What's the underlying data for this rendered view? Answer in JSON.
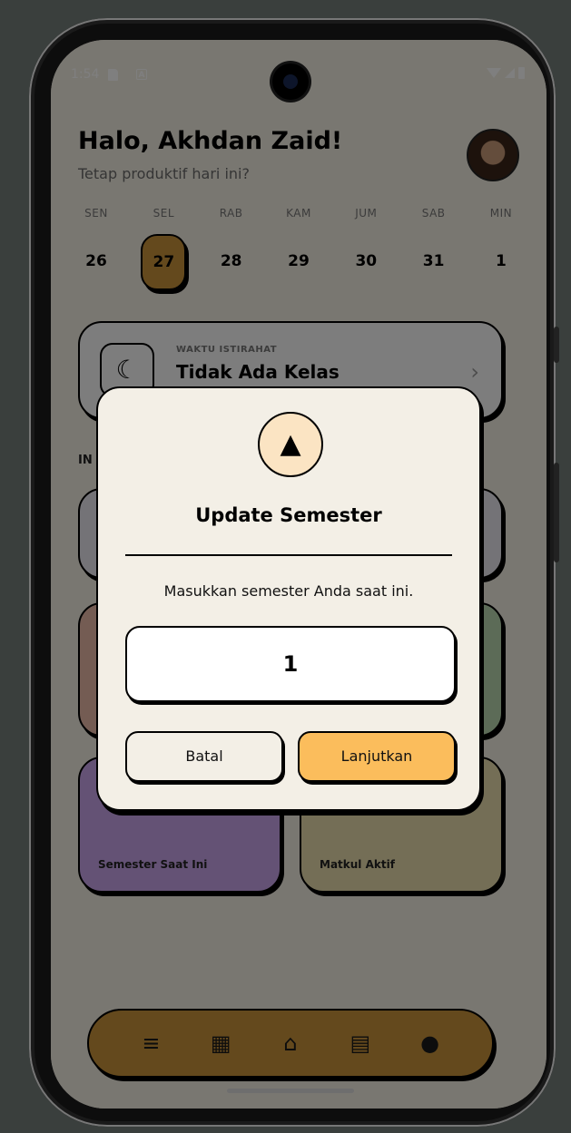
{
  "status": {
    "time": "1:54",
    "notif_a": "A"
  },
  "header": {
    "greeting": "Halo, Akhdan Zaid!",
    "subtitle": "Tetap produktif hari ini?"
  },
  "calendar": {
    "days": [
      {
        "name": "SEN",
        "date": "26"
      },
      {
        "name": "SEL",
        "date": "27",
        "active": true
      },
      {
        "name": "RAB",
        "date": "28"
      },
      {
        "name": "KAM",
        "date": "29"
      },
      {
        "name": "JUM",
        "date": "30"
      },
      {
        "name": "SAB",
        "date": "31"
      },
      {
        "name": "MIN",
        "date": "1"
      }
    ]
  },
  "rest_card": {
    "label": "WAKTU ISTIRAHAT",
    "title": "Tidak Ada Kelas",
    "icon": "moon-icon"
  },
  "section": {
    "label": "IN"
  },
  "stats": {
    "semester_label": "Semester Saat Ini",
    "courses_label": "Matkul Aktif"
  },
  "nav": {
    "icons": [
      "edit-list-icon",
      "calendar-icon",
      "home-icon",
      "clipboard-icon",
      "person-icon"
    ]
  },
  "dialog": {
    "icon": "graduation-cap-icon",
    "title": "Update Semester",
    "message": "Masukkan semester Anda saat ini.",
    "input_value": "1",
    "cancel_label": "Batal",
    "confirm_label": "Lanjutkan"
  },
  "colors": {
    "accent": "#C8923A",
    "confirm": "#FBBD5C",
    "dialog_bg": "#F3EFE6"
  }
}
